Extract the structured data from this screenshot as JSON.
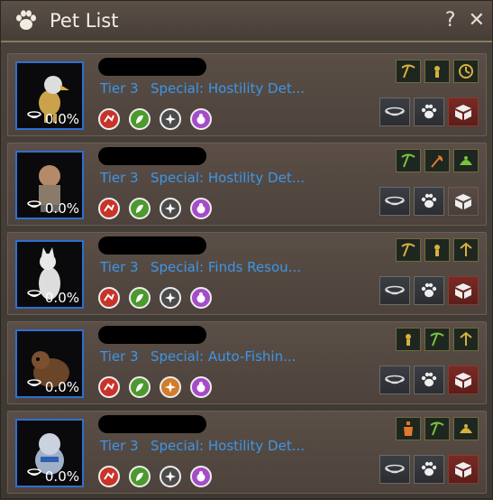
{
  "window": {
    "title": "Pet List",
    "help_label": "?",
    "close_label": "✕"
  },
  "colors": {
    "tier_text": "#3c96e8",
    "portrait_border": "#2f6fd0"
  },
  "pets": [
    {
      "image": "eagle-pet-icon",
      "feed": "0.0%",
      "tier": "Tier 3",
      "special": "Special: Hostility Det...",
      "skills": [
        "red",
        "green",
        "gray",
        "purple"
      ],
      "traits": [
        "gold-pickaxe-icon",
        "gold-woodcut-icon",
        "gold-clock-icon"
      ],
      "release_active": true
    },
    {
      "image": "goblin-pet-icon",
      "feed": "0.0%",
      "tier": "Tier 3",
      "special": "Special: Hostility Det...",
      "skills": [
        "red",
        "green",
        "gray",
        "purple"
      ],
      "traits": [
        "green-pickaxe-icon",
        "orange-axe-icon",
        "green-gather-icon"
      ],
      "release_active": false
    },
    {
      "image": "cat-pet-icon",
      "feed": "0.0%",
      "tier": "Tier 3",
      "special": "Special: Finds Resou...",
      "skills": [
        "red",
        "green",
        "gray",
        "purple"
      ],
      "traits": [
        "gold-pickaxe-icon",
        "gold-woodcut-icon",
        "gold-pick-icon"
      ],
      "release_active": true
    },
    {
      "image": "otter-pet-icon",
      "feed": "0.0%",
      "tier": "Tier 3",
      "special": "Special: Auto-Fishin...",
      "skills": [
        "red",
        "green",
        "orange",
        "purple"
      ],
      "traits": [
        "gold-woodcut-icon",
        "green-pickaxe-icon",
        "gold-pick-icon"
      ],
      "release_active": true
    },
    {
      "image": "dog-pet-icon",
      "feed": "0.0%",
      "tier": "Tier 3",
      "special": "Special: Hostility Det...",
      "skills": [
        "red",
        "green",
        "gray",
        "purple"
      ],
      "traits": [
        "orange-bottle-icon",
        "green-pickaxe-icon",
        "gold-gather-icon"
      ],
      "release_active": true
    }
  ],
  "icons": {
    "feed": "bowl-icon",
    "paw": "paw-icon",
    "release": "release-box-icon"
  }
}
